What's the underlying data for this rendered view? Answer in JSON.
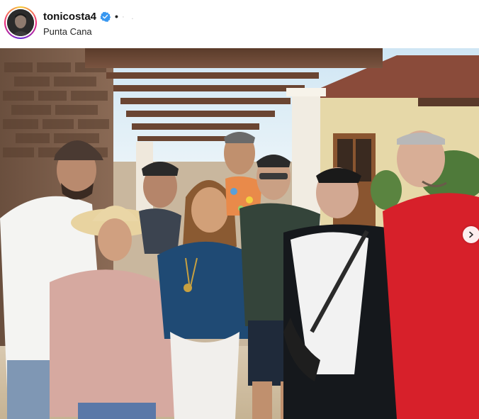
{
  "post": {
    "username": "tonicosta4",
    "verified_icon": "verified-badge-icon",
    "separator": "•",
    "location": "Punta Cana"
  },
  "photo": {
    "alt": "Group photo on a patio under a wooden pergola",
    "subject_count": 9
  },
  "carousel": {
    "next_icon": "chevron-right-icon"
  },
  "colors": {
    "verified_blue": "#3897f0",
    "ring_gradient": [
      "#f9ce34",
      "#ee2a7b",
      "#6228d7"
    ]
  }
}
